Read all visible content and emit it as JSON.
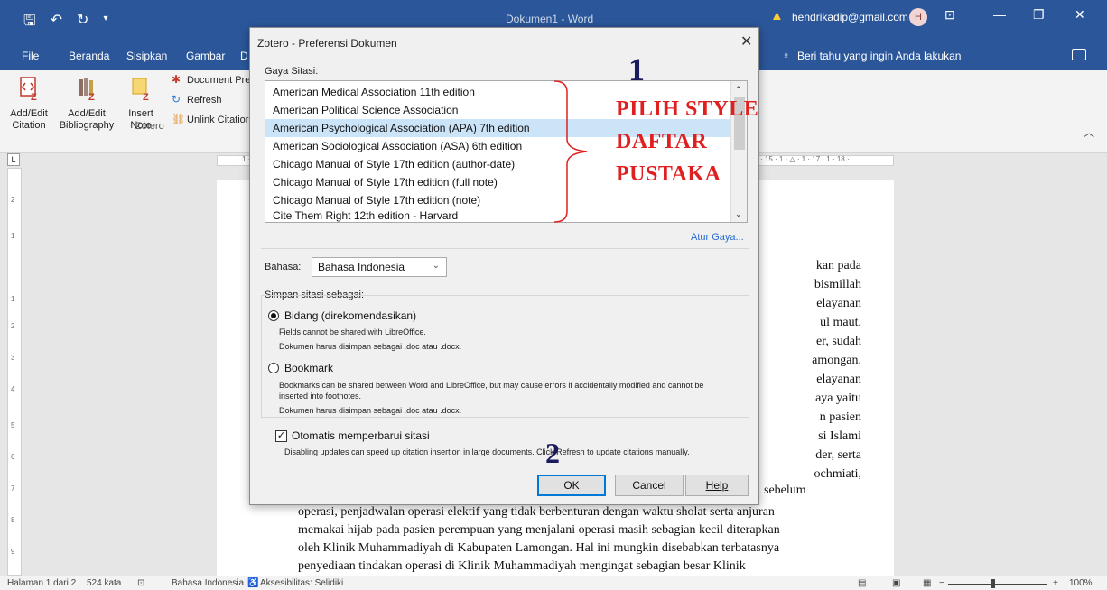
{
  "titlebar": {
    "doc_title": "Dokumen1 - Word",
    "email": "hendrikadip@gmail.com",
    "avatar_initial": "H"
  },
  "ribbon_tabs": [
    "File",
    "Beranda",
    "Sisipkan",
    "Gambar",
    "D"
  ],
  "tell_me": "Beri tahu yang ingin Anda lakukan",
  "ribbon": {
    "add_edit_citation": [
      "Add/Edit",
      "Citation"
    ],
    "add_edit_bibliography": [
      "Add/Edit",
      "Bibliography"
    ],
    "insert_note": [
      "Insert",
      "Note"
    ],
    "document_prefs": "Document Pre",
    "refresh": "Refresh",
    "unlink": "Unlink Citatior",
    "group_label": "Zotero"
  },
  "ruler": {
    "h_left": "1 · 2 ·",
    "h_right": "· 15 · 1 · △ · 1 · 17 · 1 · 18 ·"
  },
  "dialog": {
    "title": "Zotero - Preferensi Dokumen",
    "style_label": "Gaya Sitasi:",
    "styles": [
      "American Medical Association 11th edition",
      "American Political Science Association",
      "American Psychological Association (APA) 7th edition",
      "American Sociological Association (ASA) 6th edition",
      "Chicago Manual of Style 17th edition (author-date)",
      "Chicago Manual of Style 17th edition (full note)",
      "Chicago Manual of Style 17th edition (note)",
      "Cite Them Right 12th edition - Harvard"
    ],
    "selected_index": 2,
    "manage_styles": "Atur Gaya...",
    "language_label": "Bahasa:",
    "language_value": "Bahasa Indonesia",
    "store_label": "Simpan sitasi sebagai:",
    "fields_label": "Bidang (direkomendasikan)",
    "fields_note1": "Fields cannot be shared with LibreOffice.",
    "fields_note2": "Dokumen harus disimpan sebagai .doc atau .docx.",
    "bookmark_label": "Bookmark",
    "bookmark_note1": "Bookmarks can be shared between Word and LibreOffice, but may cause errors if accidentally modified and cannot be",
    "bookmark_note1b": "inserted into footnotes.",
    "bookmark_note2": "Dokumen harus disimpan sebagai .doc atau .docx.",
    "auto_update_label": "Otomatis memperbarui sitasi",
    "auto_update_checked": true,
    "auto_update_note": "Disabling updates can speed up citation insertion in large documents. Click Refresh to update citations manually.",
    "ok": "OK",
    "cancel": "Cancel",
    "help": "Help"
  },
  "annotations": {
    "step1": "1",
    "step1_text": [
      "PILIH STYLE",
      "DAFTAR",
      "PUSTAKA"
    ],
    "step2": "2",
    "color": "#e02020"
  },
  "document": {
    "right_lines": [
      "kan pada",
      "bismillah",
      "elayanan",
      "ul  maut,",
      "er,  sudah",
      "amongan.",
      "elayanan",
      "aya  yaitu",
      "n  pasien",
      "si  Islami",
      "der,  serta",
      "ochmiati,"
    ],
    "sebelum": "sebelum",
    "bottom_lines": [
      "operasi, penjadwalan operasi elektif yang tidak berbenturan dengan waktu sholat serta anjuran",
      "memakai hijab pada pasien perempuan yang menjalani operasi masih sebagian kecil diterapkan",
      "oleh Klinik Muhammadiyah di Kabupaten Lamongan. Hal ini mungkin disebabkan terbatasnya",
      "penyediaan tindakan operasi di Klinik Muhammadiyah mengingat sebagian besar Klinik"
    ]
  },
  "status": {
    "page": "Halaman 1 dari 2",
    "words": "524 kata",
    "language": "Bahasa Indonesia",
    "accessibility": "Aksesibilitas: Selidiki",
    "zoom": "100%"
  }
}
